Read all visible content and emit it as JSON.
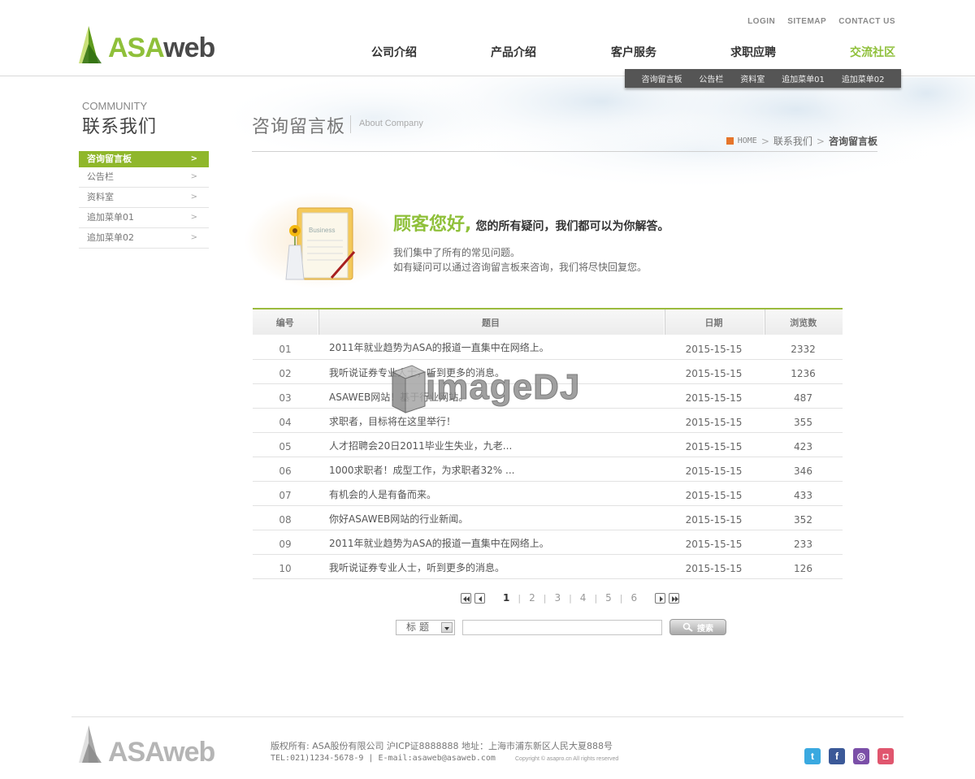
{
  "brand": {
    "asa": "ASA",
    "web": "web"
  },
  "util_nav": [
    "LOGIN",
    "SITEMAP",
    "CONTACT US"
  ],
  "main_nav": [
    "公司介绍",
    "产品介绍",
    "客户服务",
    "求职应聘",
    "交流社区"
  ],
  "main_nav_active": "交流社区",
  "sub_nav": [
    "咨询留言板",
    "公告栏",
    "资料室",
    "追加菜单01",
    "追加菜单02"
  ],
  "sidebar": {
    "eng_title": "COMMUNITY",
    "title": "联系我们",
    "items": [
      {
        "label": "咨询留言板",
        "arrow": ">"
      },
      {
        "label": "公告栏",
        "arrow": ">"
      },
      {
        "label": "资料室",
        "arrow": ">"
      },
      {
        "label": "追加菜单01",
        "arrow": ">"
      },
      {
        "label": "追加菜单02",
        "arrow": ">"
      }
    ]
  },
  "content": {
    "title": "咨询留言板",
    "sub": "About Company",
    "breadcrumb": {
      "home": "HOME",
      "level1": "联系我们",
      "current": "咨询留言板",
      "sep": ">"
    }
  },
  "intro": {
    "illus_label": "Business",
    "heading_green": "顾客您好,",
    "heading_dark": "您的所有疑问，我们都可以为你解答。",
    "line1": "我们集中了所有的常见问题。",
    "line2": "如有疑问可以通过咨询留言板来咨询，我们将尽快回复您。"
  },
  "table": {
    "headers": {
      "no": "编号",
      "title": "题目",
      "date": "日期",
      "views": "浏览数"
    },
    "rows": [
      {
        "no": "01",
        "title": "2011年就业趋势为ASA的报道一直集中在网络上。",
        "date": "2015-15-15",
        "views": "2332"
      },
      {
        "no": "02",
        "title": "我听说证券专业人士，听到更多的消息。",
        "date": "2015-15-15",
        "views": "1236"
      },
      {
        "no": "03",
        "title": "ASAWEB网站！基于行业网站。",
        "date": "2015-15-15",
        "views": "487"
      },
      {
        "no": "04",
        "title": "求职者，目标将在这里举行！",
        "date": "2015-15-15",
        "views": "355"
      },
      {
        "no": "05",
        "title": "人才招聘会20日2011毕业生失业，九老...",
        "date": "2015-15-15",
        "views": "423"
      },
      {
        "no": "06",
        "title": "1000求职者！成型工作，为求职者32% ...",
        "date": "2015-15-15",
        "views": "346"
      },
      {
        "no": "07",
        "title": "有机会的人是有备而来。",
        "date": "2015-15-15",
        "views": "433"
      },
      {
        "no": "08",
        "title": "你好ASAWEB网站的行业新闻。",
        "date": "2015-15-15",
        "views": "352"
      },
      {
        "no": "09",
        "title": "2011年就业趋势为ASA的报道一直集中在网络上。",
        "date": "2015-15-15",
        "views": "233"
      },
      {
        "no": "10",
        "title": "我听说证券专业人士，听到更多的消息。",
        "date": "2015-15-15",
        "views": "126"
      }
    ]
  },
  "pager": {
    "pages": [
      "1",
      "2",
      "3",
      "4",
      "5",
      "6"
    ],
    "current": "1",
    "sep": "|"
  },
  "search": {
    "select_label": "标题",
    "input_value": "",
    "button_label": "搜索"
  },
  "footer": {
    "brand": "ASAweb",
    "line1": "版权所有: ASA股份有限公司 沪ICP证8888888 地址：上海市浦东新区人民大夏888号",
    "line2": "TEL:021)1234-5678-9 | E-mail:asaweb@asaweb.com",
    "copyright": "Copyright © asapro.cn All rights reserved",
    "social": [
      {
        "name": "twitter-icon",
        "glyph": "t",
        "color": "#3aa9e0"
      },
      {
        "name": "facebook-icon",
        "glyph": "f",
        "color": "#3b5998"
      },
      {
        "name": "podcast-icon",
        "glyph": "◎",
        "color": "#7b4fa8"
      },
      {
        "name": "instagram-icon",
        "glyph": "◘",
        "color": "#e0566e"
      }
    ]
  },
  "watermark": "imageDJ",
  "colors": {
    "brand_green": "#8fc03a",
    "dark": "#555555",
    "accent_orange": "#e6752b"
  }
}
